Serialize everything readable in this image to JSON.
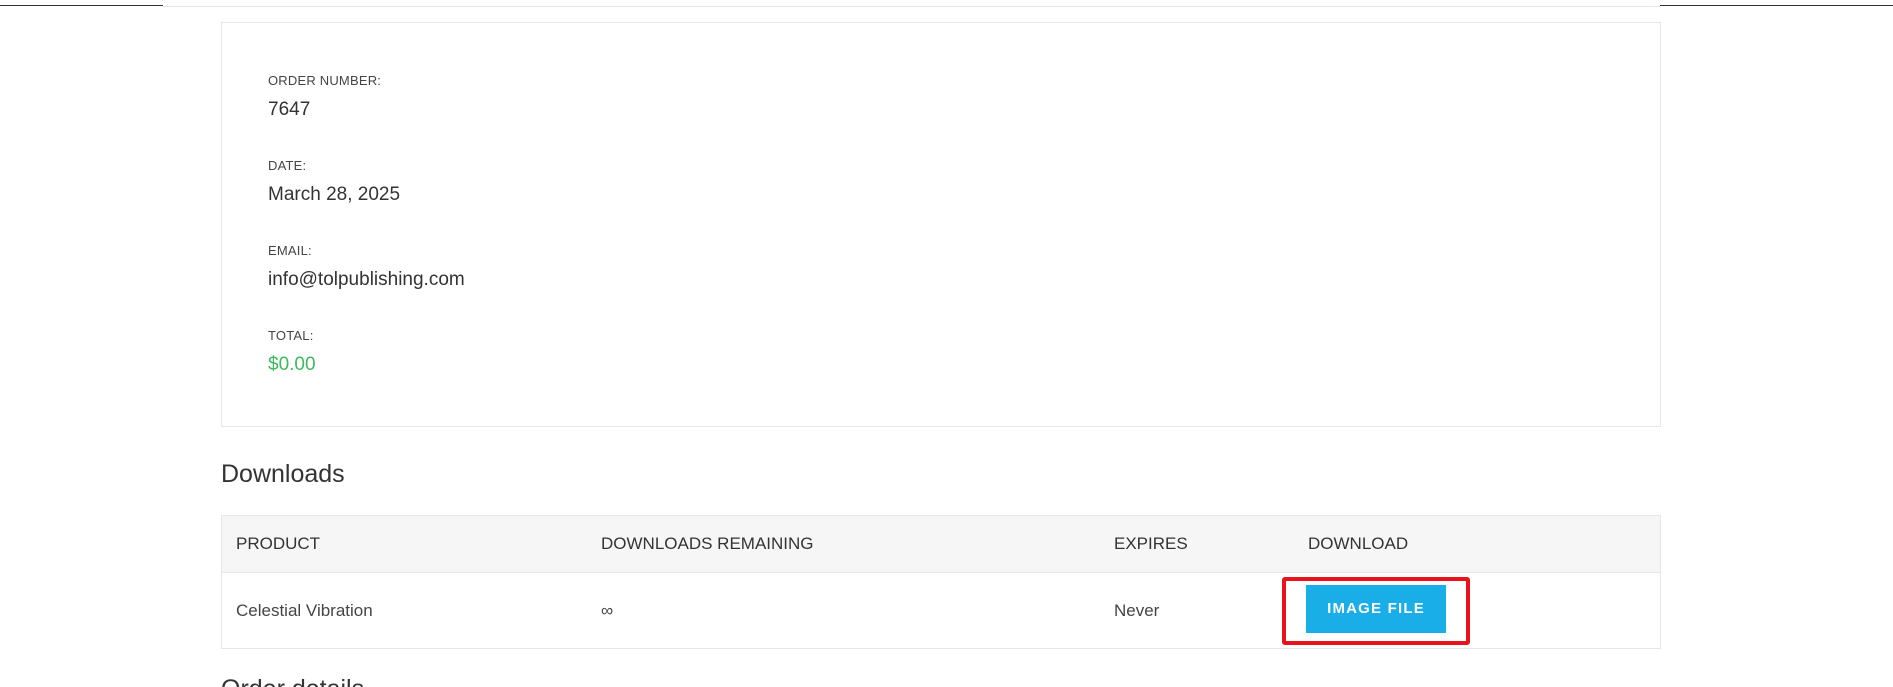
{
  "order": {
    "fields": [
      {
        "label": "ORDER NUMBER:",
        "value": "7647"
      },
      {
        "label": "DATE:",
        "value": "March 28, 2025"
      },
      {
        "label": "EMAIL:",
        "value": "info@tolpublishing.com"
      },
      {
        "label": "TOTAL:",
        "value": "$0.00"
      }
    ]
  },
  "downloads": {
    "title": "Downloads",
    "columns": [
      "PRODUCT",
      "DOWNLOADS REMAINING",
      "EXPIRES",
      "DOWNLOAD"
    ],
    "rows": [
      {
        "product": "Celestial Vibration",
        "remaining": "∞",
        "expires": "Never",
        "download_label": "IMAGE FILE"
      }
    ]
  },
  "next_section": {
    "title": "Order details"
  },
  "colors": {
    "accent": "#1aaee8",
    "total": "#3dba5a",
    "highlight": "#e8141c"
  }
}
